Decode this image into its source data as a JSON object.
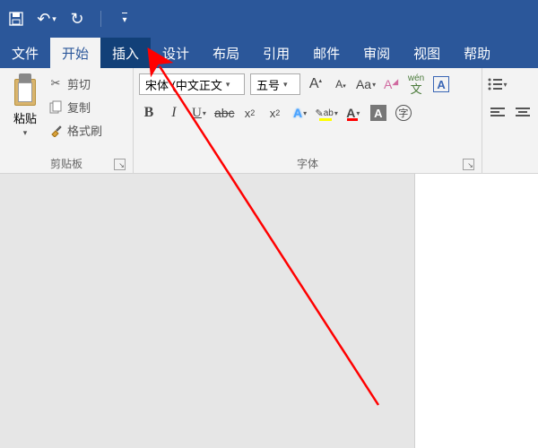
{
  "qat": {
    "save": "💾",
    "undo": "↶",
    "redo": "↻",
    "more": "▾"
  },
  "tabs": {
    "file": "文件",
    "home": "开始",
    "insert": "插入",
    "design": "设计",
    "layout": "布局",
    "references": "引用",
    "mailings": "邮件",
    "review": "审阅",
    "view": "视图",
    "help": "帮助"
  },
  "clipboard": {
    "paste": "粘贴",
    "cut": "剪切",
    "copy": "复制",
    "format_painter": "格式刷",
    "group_label": "剪贴板"
  },
  "font": {
    "name": "宋体 (中文正文",
    "size": "五号",
    "grow": "A",
    "shrink": "A",
    "change_case": "Aa",
    "clear_fmt": "A",
    "phonetic": "wén",
    "char_border": "A",
    "bold": "B",
    "italic": "I",
    "underline": "U",
    "strike": "abc",
    "sub": "x",
    "sup": "x",
    "text_effects": "A",
    "highlight": "ab",
    "font_color": "A",
    "char_shading": "A",
    "enclose": "字",
    "group_label": "字体"
  },
  "colors": {
    "highlight": "#ffff00",
    "font_color": "#ff0000",
    "text_effect": "#4aa3ff"
  }
}
